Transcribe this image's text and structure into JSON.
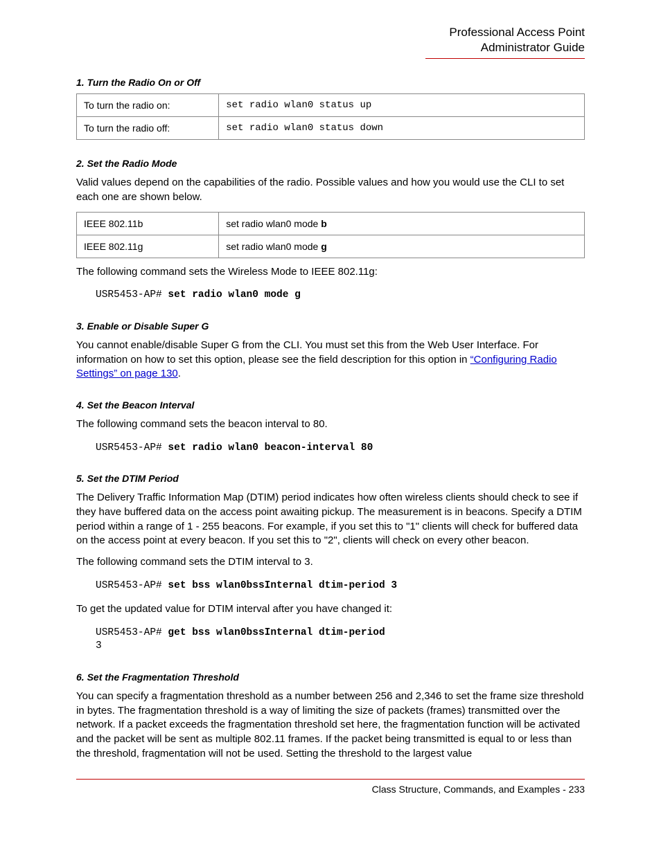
{
  "header": {
    "line1": "Professional Access Point",
    "line2": "Administrator Guide"
  },
  "s1": {
    "title": "1. Turn the Radio On or Off",
    "rows": [
      {
        "label": "To turn the radio on:",
        "cmd": "set radio wlan0 status up"
      },
      {
        "label": "To turn the radio off:",
        "cmd": "set radio wlan0 status down"
      }
    ]
  },
  "s2": {
    "title": "2. Set the Radio Mode",
    "intro": "Valid values depend on the capabilities of the radio. Possible values and how you would use the CLI to set each one are shown below.",
    "rows": [
      {
        "label": "IEEE 802.11b",
        "cmd_prefix": "set radio wlan0 mode ",
        "cmd_bold": "b"
      },
      {
        "label": "IEEE 802.11g",
        "cmd_prefix": "set radio wlan0 mode ",
        "cmd_bold": "g"
      }
    ],
    "after": "The following command sets the Wireless Mode to IEEE 802.11g:",
    "cli_prompt": "USR5453-AP# ",
    "cli_cmd": "set radio wlan0 mode g"
  },
  "s3": {
    "title": "3. Enable or Disable Super G",
    "text_before_link": "You cannot enable/disable Super G from the CLI. You must set this from the Web User Interface. For information on how to set this option, please see the field description for this option in ",
    "link_text": "“Configuring Radio Settings” on page 130",
    "text_after_link": "."
  },
  "s4": {
    "title": "4. Set the Beacon Interval",
    "intro": "The following command sets the beacon interval to 80.",
    "cli_prompt": "USR5453-AP# ",
    "cli_cmd": "set radio wlan0 beacon-interval 80"
  },
  "s5": {
    "title": "5. Set the DTIM Period",
    "para1": "The Delivery Traffic Information Map (DTIM) period indicates how often wireless clients should check to see if they have buffered data on the access point awaiting pickup. The measurement is in beacons. Specify a DTIM period within a range of 1 - 255 beacons. For example, if you set this to \"1\" clients will check for buffered data on the access point at every beacon. If you set this to \"2\", clients will check on every other beacon.",
    "para2": "The following command sets the DTIM interval to 3.",
    "cli1_prompt": "USR5453-AP# ",
    "cli1_cmd": "set bss wlan0bssInternal dtim-period 3",
    "para3": "To get the updated value for DTIM interval after you have changed it:",
    "cli2_prompt": "USR5453-AP# ",
    "cli2_cmd": "get bss wlan0bssInternal dtim-period",
    "cli2_out": "3"
  },
  "s6": {
    "title": "6. Set the Fragmentation Threshold",
    "para": "You can specify a fragmentation threshold as a number between 256 and 2,346 to set the frame size threshold in bytes. The fragmentation threshold is a way of limiting the size of packets (frames) transmitted over the network. If a packet exceeds the fragmentation threshold set here, the fragmentation function will be activated and the packet will be sent as multiple 802.11 frames. If the packet being transmitted is equal to or less than the threshold, fragmentation will not be used. Setting the threshold to the largest value"
  },
  "footer": {
    "text": "Class Structure, Commands, and Examples - 233"
  }
}
